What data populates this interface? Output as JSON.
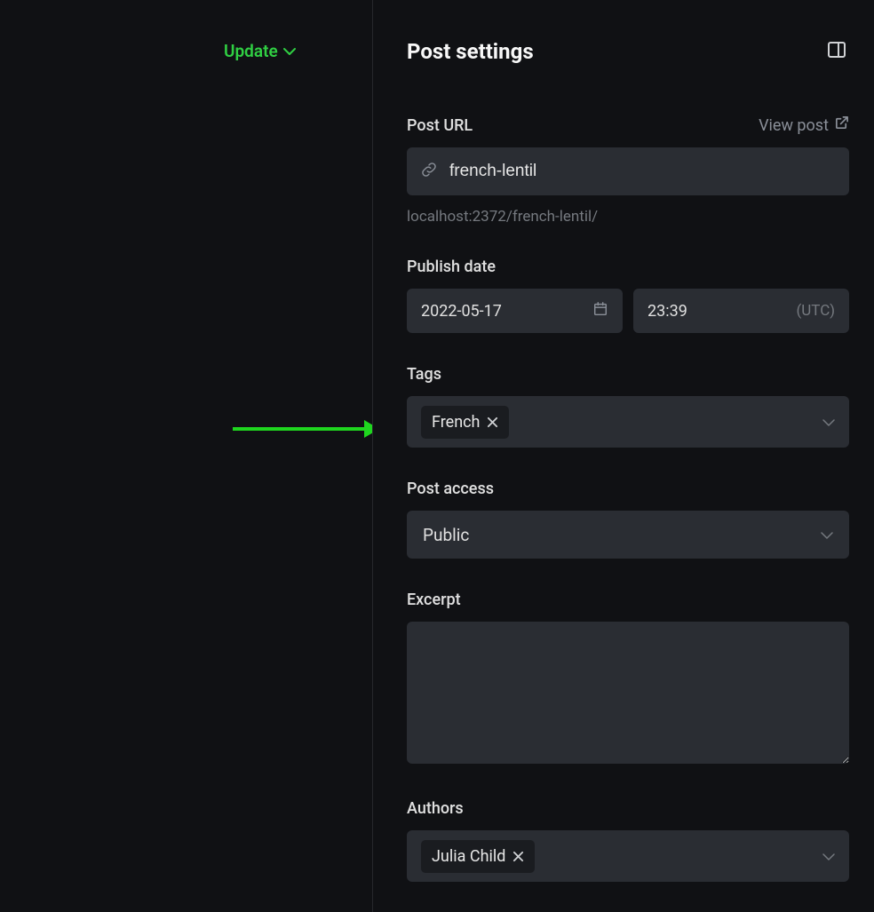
{
  "header": {
    "update_label": "Update"
  },
  "sidebar": {
    "title": "Post settings",
    "post_url": {
      "label": "Post URL",
      "view_label": "View post",
      "value": "french-lentil",
      "preview": "localhost:2372/french-lentil/"
    },
    "publish_date": {
      "label": "Publish date",
      "date": "2022-05-17",
      "time": "23:39",
      "tz": "(UTC)"
    },
    "tags": {
      "label": "Tags",
      "items": [
        "French"
      ]
    },
    "post_access": {
      "label": "Post access",
      "value": "Public"
    },
    "excerpt": {
      "label": "Excerpt",
      "value": ""
    },
    "authors": {
      "label": "Authors",
      "items": [
        "Julia Child"
      ]
    }
  }
}
